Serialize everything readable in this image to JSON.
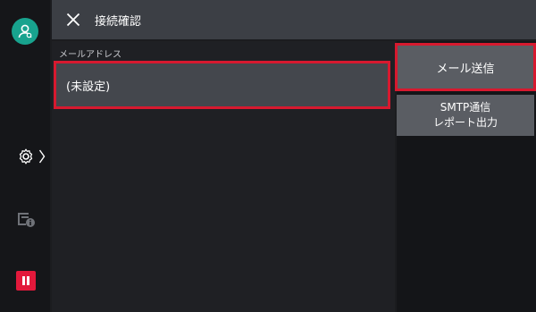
{
  "header": {
    "title": "接続確認"
  },
  "main": {
    "field_label": "メールアドレス",
    "field_value": "(未設定)"
  },
  "actions": {
    "send_label": "メール送信",
    "smtp_label_line1": "SMTP通信",
    "smtp_label_line2": "レポート出力"
  },
  "colors": {
    "accent_highlight": "#d7192f",
    "user_icon_bg": "#18a38e",
    "pause_bg": "#e2193b"
  },
  "icons": {
    "rail_user": "user-icon",
    "rail_settings": "gear-icon",
    "rail_jobs": "job-status-icon",
    "rail_pause": "pause-icon",
    "close": "close-icon"
  }
}
